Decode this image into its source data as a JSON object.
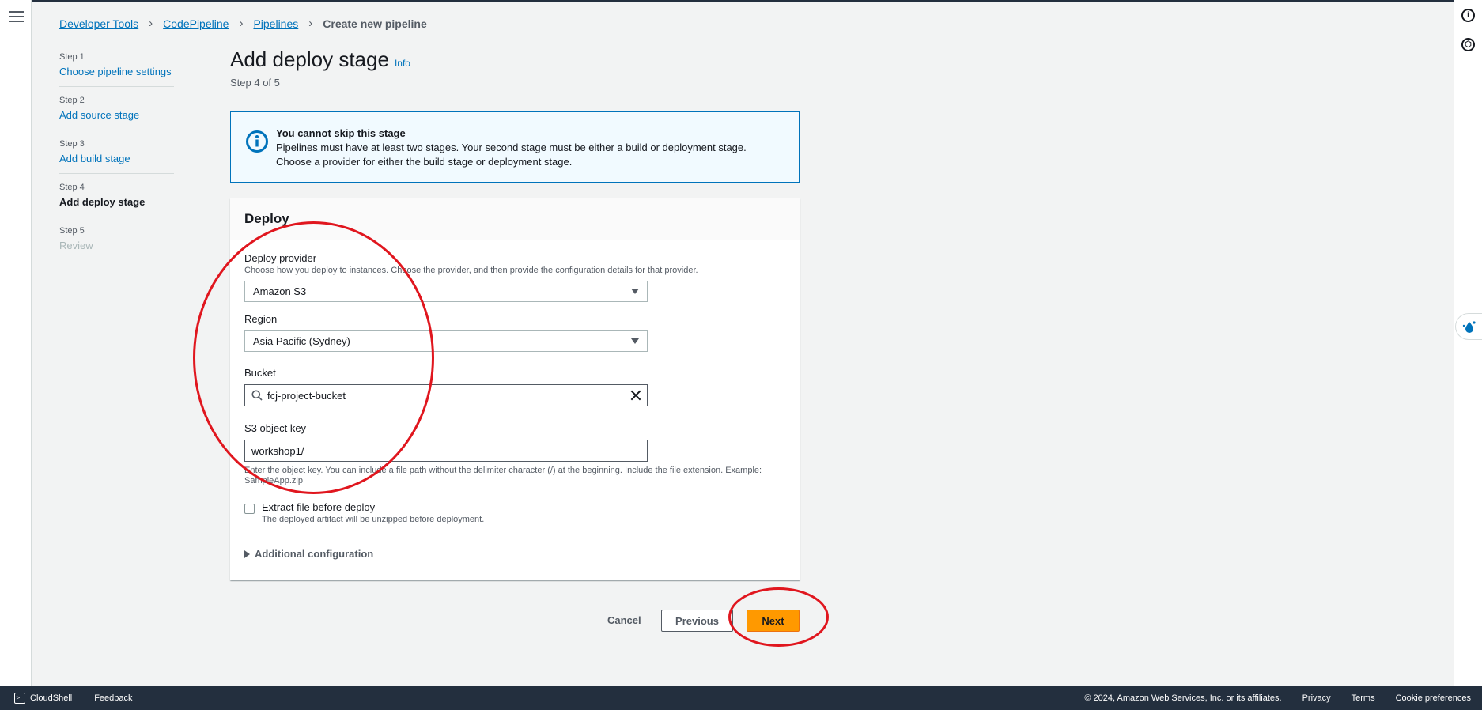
{
  "breadcrumb": {
    "items": [
      "Developer Tools",
      "CodePipeline",
      "Pipelines"
    ],
    "current": "Create new pipeline"
  },
  "steps": [
    {
      "num": "Step 1",
      "label": "Choose pipeline settings",
      "state": "link"
    },
    {
      "num": "Step 2",
      "label": "Add source stage",
      "state": "link"
    },
    {
      "num": "Step 3",
      "label": "Add build stage",
      "state": "link"
    },
    {
      "num": "Step 4",
      "label": "Add deploy stage",
      "state": "active"
    },
    {
      "num": "Step 5",
      "label": "Review",
      "state": "disabled"
    }
  ],
  "page": {
    "title": "Add deploy stage",
    "info": "Info",
    "subtitle": "Step 4 of 5"
  },
  "alert": {
    "title": "You cannot skip this stage",
    "body": "Pipelines must have at least two stages. Your second stage must be either a build or deployment stage. Choose a provider for either the build stage or deployment stage."
  },
  "deploy": {
    "header": "Deploy",
    "provider_label": "Deploy provider",
    "provider_desc": "Choose how you deploy to instances. Choose the provider, and then provide the configuration details for that provider.",
    "provider_value": "Amazon S3",
    "region_label": "Region",
    "region_value": "Asia Pacific (Sydney)",
    "bucket_label": "Bucket",
    "bucket_value": "fcj-project-bucket",
    "key_label": "S3 object key",
    "key_value": "workshop1/",
    "key_desc": "Enter the object key. You can include a file path without the delimiter character (/) at the beginning. Include the file extension. Example: SampleApp.zip",
    "extract_label": "Extract file before deploy",
    "extract_desc": "The deployed artifact will be unzipped before deployment.",
    "additional": "Additional configuration"
  },
  "actions": {
    "cancel": "Cancel",
    "previous": "Previous",
    "next": "Next"
  },
  "footer": {
    "cloudshell": "CloudShell",
    "feedback": "Feedback",
    "copyright": "© 2024, Amazon Web Services, Inc. or its affiliates.",
    "privacy": "Privacy",
    "terms": "Terms",
    "cookies": "Cookie preferences"
  },
  "colors": {
    "link": "#0073bb",
    "primary_button": "#ff9900",
    "annotation": "#e0161e",
    "footer_bg": "#232f3e"
  }
}
